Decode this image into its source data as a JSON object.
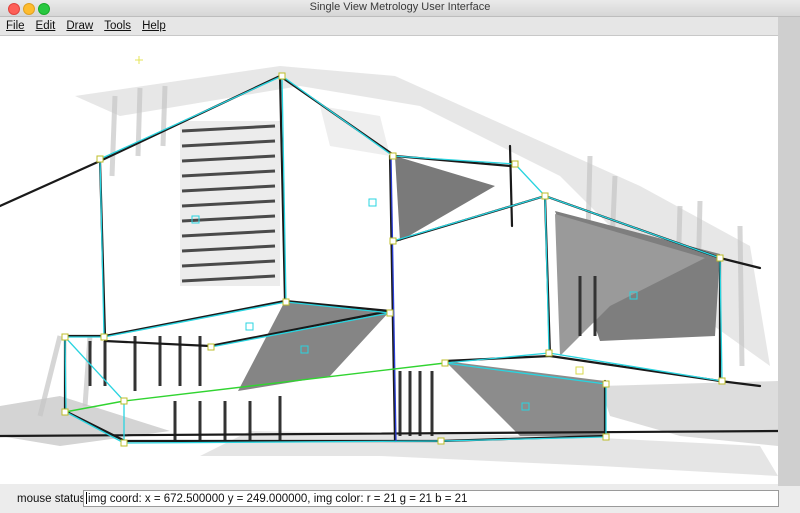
{
  "window": {
    "title": "Single View Metrology User Interface"
  },
  "menu": [
    "File",
    "Edit",
    "Draw",
    "Tools",
    "Help"
  ],
  "status": {
    "label": "mouse status:",
    "text": "img coord: x = 672.500000 y = 249.000000, img color: r = 21 g = 21 b = 21"
  },
  "colors": {
    "cyan_line": "#29d4e0",
    "green_line": "#31d431",
    "marker": "#d8d84a"
  }
}
